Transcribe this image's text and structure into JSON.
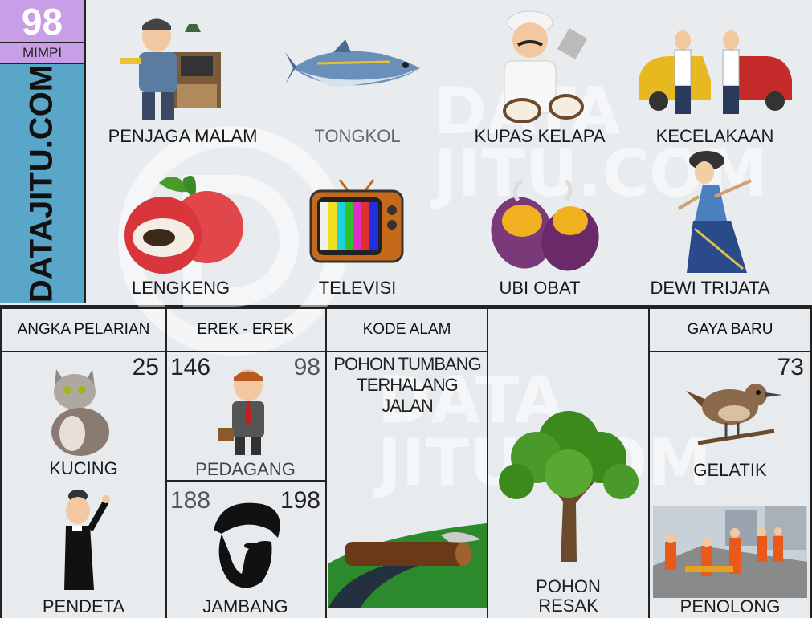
{
  "badge": {
    "number": "98",
    "mimpi": "MIMPI"
  },
  "site": {
    "name": "DATAJITU.COM",
    "watermark": "DATA JITU.COM"
  },
  "top_items": [
    {
      "label": "PENJAGA MALAM"
    },
    {
      "label": "TONGKOL"
    },
    {
      "label": "KUPAS KELAPA"
    },
    {
      "label": "KECELAKAAN"
    },
    {
      "label": "LENGKENG"
    },
    {
      "label": "TELEVISI"
    },
    {
      "label": "UBI OBAT"
    },
    {
      "label": "DEWI TRIJATA"
    }
  ],
  "headers": {
    "angka_pelarian": "ANGKA PELARIAN",
    "erek": "EREK - EREK",
    "kode_alam": "KODE ALAM",
    "gaya_baru": "GAYA BARU"
  },
  "angka_pelarian": {
    "number": "25",
    "item1": "KUCING",
    "item2": "PENDETA"
  },
  "erek": {
    "top": {
      "left_num": "146",
      "right_num": "98",
      "label": "PEDAGANG"
    },
    "bottom": {
      "left_num": "188",
      "right_num": "198",
      "label": "JAMBANG"
    }
  },
  "kode_alam": {
    "text": "POHON TUMBANG TERHALANG JALAN"
  },
  "pohon": {
    "line1": "POHON",
    "line2": "RESAK"
  },
  "gaya_baru": {
    "number": "73",
    "item1": "GELATIK",
    "item2": "PENOLONG"
  },
  "colors": {
    "badge": "#c89ee6",
    "side": "#5aa6c8",
    "tv": "#c46a1a",
    "tree": "#3c8a1c"
  }
}
